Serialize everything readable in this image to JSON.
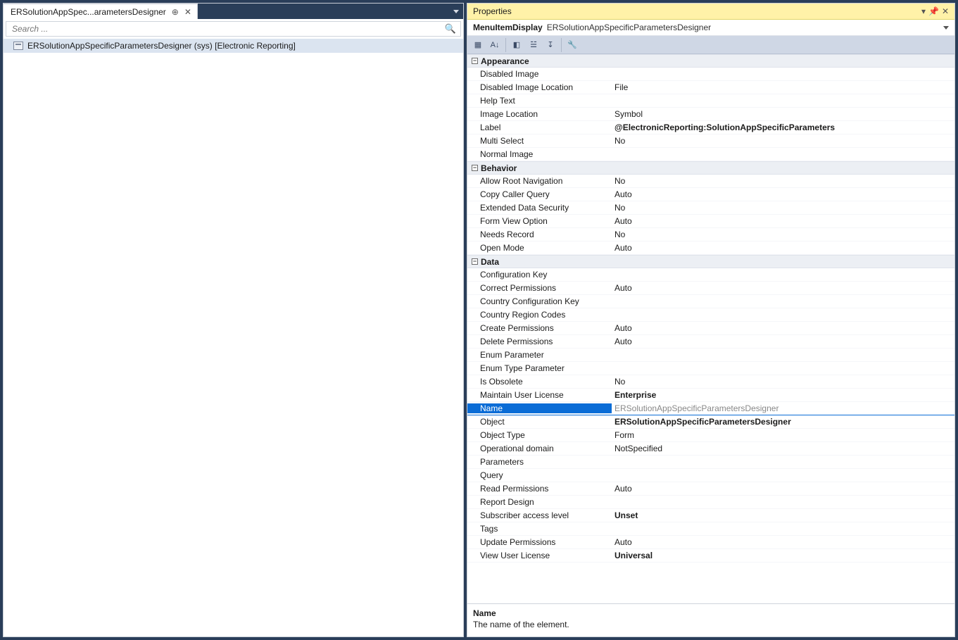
{
  "left": {
    "tab_title": "ERSolutionAppSpec...arametersDesigner",
    "search_placeholder": "Search ...",
    "tree_item": "ERSolutionAppSpecificParametersDesigner (sys) [Electronic Reporting]"
  },
  "right": {
    "panel_title": "Properties",
    "head_type": "MenuItemDisplay",
    "head_name": "ERSolutionAppSpecificParametersDesigner",
    "desc_name": "Name",
    "desc_text": "The name of the element.",
    "selected_key": "Name"
  },
  "categories": [
    {
      "name": "Appearance",
      "props": [
        {
          "k": "Disabled Image",
          "v": "",
          "bold": false
        },
        {
          "k": "Disabled Image Location",
          "v": "File",
          "bold": false
        },
        {
          "k": "Help Text",
          "v": "",
          "bold": false
        },
        {
          "k": "Image Location",
          "v": "Symbol",
          "bold": false
        },
        {
          "k": "Label",
          "v": "@ElectronicReporting:SolutionAppSpecificParameters",
          "bold": true
        },
        {
          "k": "Multi Select",
          "v": "No",
          "bold": false
        },
        {
          "k": "Normal Image",
          "v": "",
          "bold": false
        }
      ]
    },
    {
      "name": "Behavior",
      "props": [
        {
          "k": "Allow Root Navigation",
          "v": "No",
          "bold": false
        },
        {
          "k": "Copy Caller Query",
          "v": "Auto",
          "bold": false
        },
        {
          "k": "Extended Data Security",
          "v": "No",
          "bold": false
        },
        {
          "k": "Form View Option",
          "v": "Auto",
          "bold": false
        },
        {
          "k": "Needs Record",
          "v": "No",
          "bold": false
        },
        {
          "k": "Open Mode",
          "v": "Auto",
          "bold": false
        }
      ]
    },
    {
      "name": "Data",
      "props": [
        {
          "k": "Configuration Key",
          "v": "",
          "bold": false
        },
        {
          "k": "Correct Permissions",
          "v": "Auto",
          "bold": false
        },
        {
          "k": "Country Configuration Key",
          "v": "",
          "bold": false
        },
        {
          "k": "Country Region Codes",
          "v": "",
          "bold": false
        },
        {
          "k": "Create Permissions",
          "v": "Auto",
          "bold": false
        },
        {
          "k": "Delete Permissions",
          "v": "Auto",
          "bold": false
        },
        {
          "k": "Enum Parameter",
          "v": "",
          "bold": false
        },
        {
          "k": "Enum Type Parameter",
          "v": "",
          "bold": false
        },
        {
          "k": "Is Obsolete",
          "v": "No",
          "bold": false
        },
        {
          "k": "Maintain User License",
          "v": "Enterprise",
          "bold": true
        },
        {
          "k": "Name",
          "v": "ERSolutionAppSpecificParametersDesigner",
          "bold": false
        },
        {
          "k": "Object",
          "v": "ERSolutionAppSpecificParametersDesigner",
          "bold": true
        },
        {
          "k": "Object Type",
          "v": "Form",
          "bold": false
        },
        {
          "k": "Operational domain",
          "v": "NotSpecified",
          "bold": false
        },
        {
          "k": "Parameters",
          "v": "",
          "bold": false
        },
        {
          "k": "Query",
          "v": "",
          "bold": false
        },
        {
          "k": "Read Permissions",
          "v": "Auto",
          "bold": false
        },
        {
          "k": "Report Design",
          "v": "",
          "bold": false
        },
        {
          "k": "Subscriber access level",
          "v": "Unset",
          "bold": true
        },
        {
          "k": "Tags",
          "v": "",
          "bold": false
        },
        {
          "k": "Update Permissions",
          "v": "Auto",
          "bold": false
        },
        {
          "k": "View User License",
          "v": "Universal",
          "bold": true
        }
      ]
    }
  ]
}
